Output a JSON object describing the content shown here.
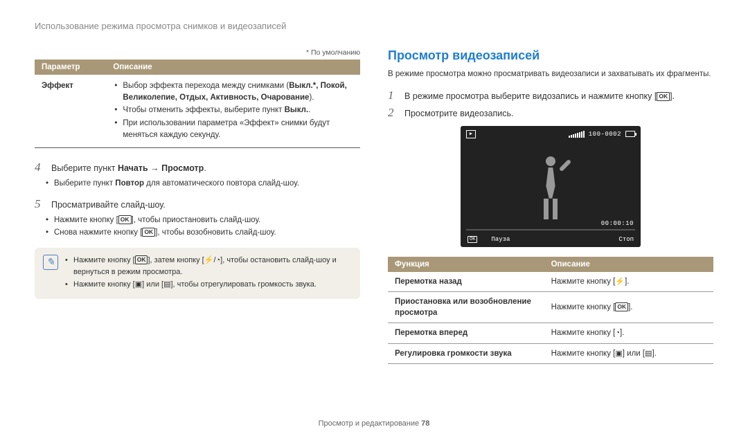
{
  "page_header": "Использование режима просмотра снимков и видеозаписей",
  "default_note": "* По умолчанию",
  "param_table": {
    "headers": [
      "Параметр",
      "Описание"
    ],
    "row_label": "Эффект",
    "bullets": {
      "b1_pre": "Выбор эффекта перехода между снимками (",
      "b1_bold": "Выкл.*, Покой, Великолепие, Отдых, Активность, Очарование",
      "b1_post": ").",
      "b2_pre": "Чтобы отменить эффекты, выберите пункт ",
      "b2_bold": "Выкл.",
      "b2_post": ".",
      "b3": "При использовании параметра «Эффект» снимки будут меняться каждую секунду."
    }
  },
  "step4": {
    "num": "4",
    "pre": "Выберите пункт ",
    "bold": "Начать → Просмотр",
    "post": ".",
    "sub_pre": "Выберите пункт ",
    "sub_bold": "Повтор",
    "sub_post": " для автоматического повтора слайд-шоу."
  },
  "step5": {
    "num": "5",
    "text": "Просматривайте слайд-шоу.",
    "sub1_a": "Нажмите кнопку [",
    "sub1_b": "], чтобы приостановить слайд-шоу.",
    "sub2_a": "Снова нажмите кнопку [",
    "sub2_b": "], чтобы возобновить слайд-шоу."
  },
  "note": {
    "n1_a": "Нажмите кнопку [",
    "n1_b": "], затем кнопку [",
    "n1_c": "], чтобы остановить слайд-шоу и вернуться в режим просмотра.",
    "n2_a": "Нажмите кнопку [",
    "n2_b": "] или [",
    "n2_c": "], чтобы отрегулировать громкость звука."
  },
  "right": {
    "heading": "Просмотр видеозаписей",
    "intro": "В режиме просмотра можно просматривать видеозаписи и захватывать их фрагменты.",
    "step1": {
      "num": "1",
      "a": "В режиме просмотра выберите видозапись и нажмите кнопку [",
      "b": "]."
    },
    "step2": {
      "num": "2",
      "text": "Просмотрите видеозапись."
    }
  },
  "video": {
    "counter": "100-0002",
    "time": "00:00:10",
    "ok": "OK",
    "pause": "Пауза",
    "stop": "Стоп"
  },
  "func_table": {
    "headers": [
      "Функция",
      "Описание"
    ],
    "rows": [
      {
        "label": "Перемотка назад",
        "desc_a": "Нажмите кнопку [",
        "desc_b": "].",
        "icon": "flash"
      },
      {
        "label": "Приостановка или возобновление просмотра",
        "desc_a": "Нажмите кнопку [",
        "desc_b": "].",
        "icon": "ok"
      },
      {
        "label": "Перемотка вперед",
        "desc_a": "Нажмите кнопку [",
        "desc_b": "].",
        "icon": "timer"
      },
      {
        "label": "Регулировка громкости звука",
        "desc_a": "Нажмите кнопку [",
        "desc_mid": "] или [",
        "desc_b": "].",
        "icon": "zoom"
      }
    ]
  },
  "footer": {
    "text": "Просмотр и редактирование ",
    "page": "78"
  },
  "icons": {
    "ok": "OK",
    "flash": "⚡",
    "timer": "◔",
    "wide": "▣",
    "tele": "▤",
    "slash": "/"
  }
}
